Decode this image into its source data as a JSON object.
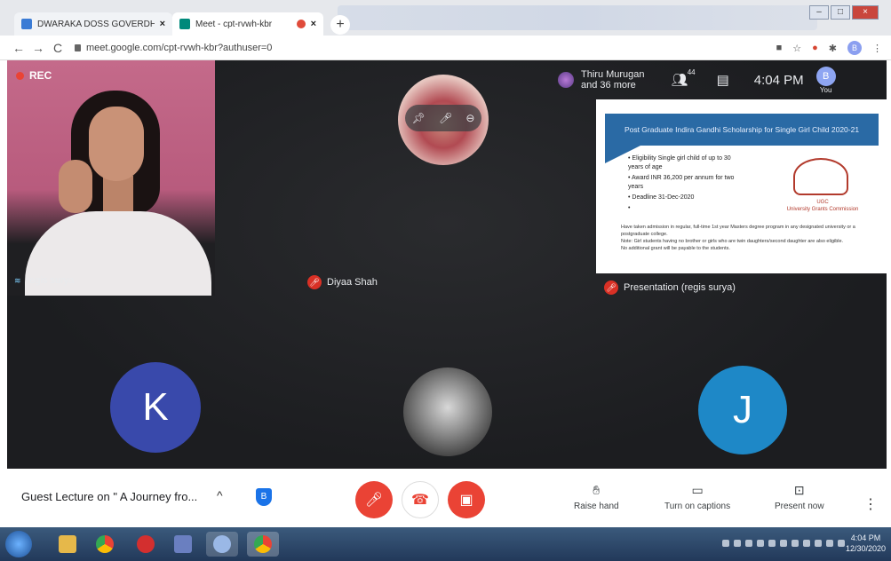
{
  "browser": {
    "tabs": [
      {
        "title": "DWARAKA DOSS GOVERDHAN",
        "icon": "doc-favicon-icon"
      },
      {
        "title": "Meet - cpt-rvwh-kbr",
        "icon": "meet-favicon-icon"
      }
    ],
    "new_tab_label": "+",
    "url": "meet.google.com/cpt-rvwh-kbr?authuser=0",
    "profile_initial": "B"
  },
  "meet": {
    "rec_label": "REC",
    "participants": [
      {
        "name": "regis surya"
      },
      {
        "name": "Diyaa Shah"
      },
      {
        "name": "Presentation (regis surya)"
      }
    ],
    "viewers_text_line1": "Thiru Murugan",
    "viewers_text_line2": "and 36 more",
    "participant_count": "44",
    "time": "4:04 PM",
    "you_label": "You",
    "you_initial": "B",
    "avatar_k": "K",
    "avatar_j": "J",
    "slide": {
      "title": "Post Graduate Indira Gandhi Scholarship for Single Girl Child 2020-21",
      "bullets": [
        "Eligibility Single girl child of up to 30 years of age",
        "Award INR 36,200 per annum for two years",
        "Deadline 31-Dec-2020",
        ""
      ],
      "logo_text_1": "UGC",
      "logo_text_2": "University Grants Commission",
      "notes_1": "Have taken admission in regular, full-time 1st year Masters degree program in any designated university or a postgraduate college.",
      "notes_2": "Note: Girl students having no brother or girls who are twin daughters/second daughter are also eligible.",
      "notes_3": "No additional grant will be payable to the students."
    }
  },
  "controls": {
    "meeting_title": "Guest Lecture on \" A Journey fro...",
    "raise_hand": "Raise hand",
    "captions": "Turn on captions",
    "present": "Present now"
  },
  "taskbar": {
    "clock_time": "4:04 PM",
    "clock_date": "12/30/2020"
  },
  "colors": {
    "meet_bg": "#202124",
    "red": "#ea4335",
    "avatar_k": "#3949ab",
    "avatar_j": "#1e88c7"
  }
}
